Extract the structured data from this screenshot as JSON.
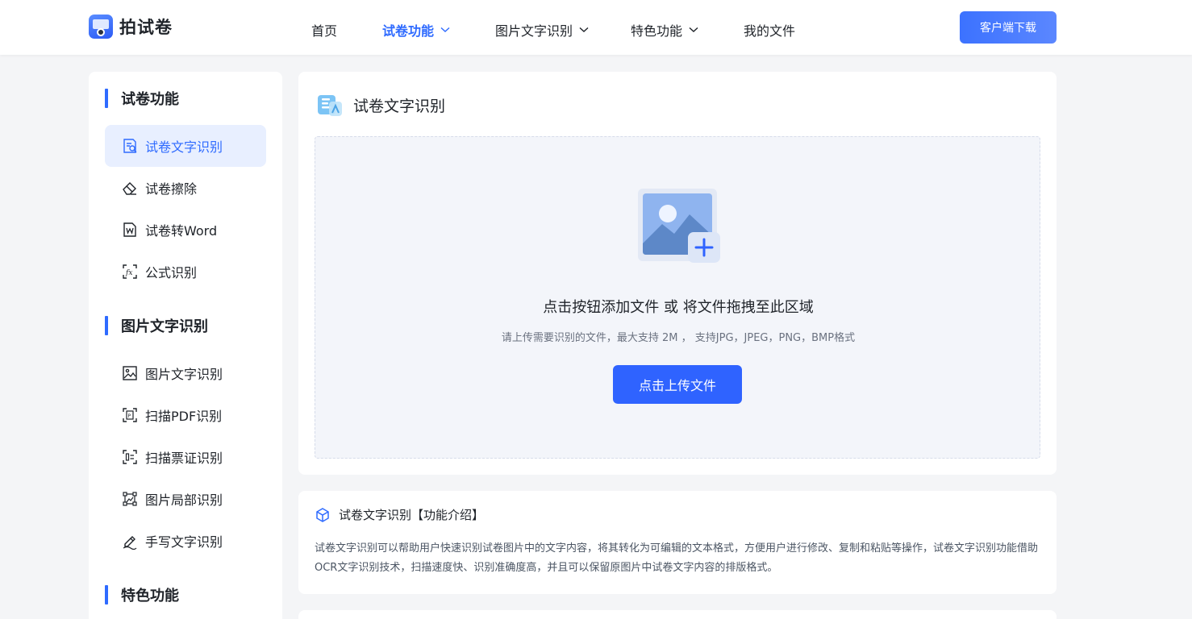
{
  "header": {
    "logo_text": "拍试卷",
    "nav": [
      {
        "label": "首页",
        "active": false,
        "dropdown": false
      },
      {
        "label": "试卷功能",
        "active": true,
        "dropdown": true
      },
      {
        "label": "图片文字识别",
        "active": false,
        "dropdown": true
      },
      {
        "label": "特色功能",
        "active": false,
        "dropdown": true
      },
      {
        "label": "我的文件",
        "active": false,
        "dropdown": false
      }
    ],
    "download_label": "客户端下载"
  },
  "sidebar": {
    "sections": [
      {
        "title": "试卷功能",
        "items": [
          {
            "label": "试卷文字识别",
            "icon": "exam-ocr-icon",
            "active": true
          },
          {
            "label": "试卷擦除",
            "icon": "eraser-icon",
            "active": false
          },
          {
            "label": "试卷转Word",
            "icon": "word-doc-icon",
            "active": false
          },
          {
            "label": "公式识别",
            "icon": "formula-icon",
            "active": false
          }
        ]
      },
      {
        "title": "图片文字识别",
        "items": [
          {
            "label": "图片文字识别",
            "icon": "image-icon",
            "active": false
          },
          {
            "label": "扫描PDF识别",
            "icon": "pdf-scan-icon",
            "active": false
          },
          {
            "label": "扫描票证识别",
            "icon": "id-card-scan-icon",
            "active": false
          },
          {
            "label": "图片局部识别",
            "icon": "crop-icon",
            "active": false
          },
          {
            "label": "手写文字识别",
            "icon": "handwriting-icon",
            "active": false
          }
        ]
      },
      {
        "title": "特色功能",
        "items": []
      }
    ]
  },
  "main": {
    "title": "试卷文字识别",
    "dropzone_text": "点击按钮添加文件 或 将文件拖拽至此区域",
    "dropzone_hint": "请上传需要识别的文件，最大支持 2M ， 支持JPG，JPEG，PNG，BMP格式",
    "upload_label": "点击上传文件"
  },
  "intro": {
    "title": "试卷文字识别【功能介绍】",
    "body": "试卷文字识别可以帮助用户快速识别试卷图片中的文字内容，将其转化为可编辑的文本格式，方便用户进行修改、复制和粘贴等操作，试卷文字识别功能借助OCR文字识别技术，扫描速度快、识别准确度高，并且可以保留原图片中试卷文字内容的排版格式。"
  },
  "colors": {
    "accent": "#2f6bff",
    "active_bg": "#e8efff",
    "page_bg": "#f4f5f7"
  }
}
